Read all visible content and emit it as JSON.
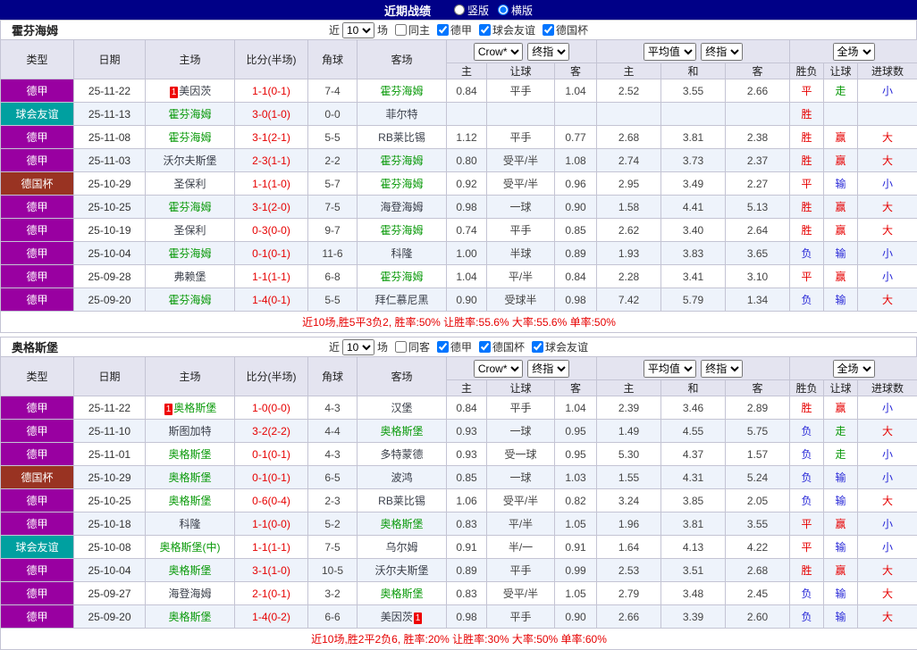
{
  "topbar": {
    "title": "近期战绩",
    "radios": [
      {
        "label": "竖版",
        "checked": false
      },
      {
        "label": "横版",
        "checked": true
      }
    ]
  },
  "league_colors": {
    "德甲": "#9900a1",
    "球会友谊": "#00a0a0",
    "德国杯": "#993322"
  },
  "result_colors": {
    "胜": "#e60000",
    "平": "#e60000",
    "负": "#2828d7",
    "赢": "#e60000",
    "输": "#2828d7",
    "走": "#0c9a0c",
    "大": "#e60000",
    "小": "#2828d7"
  },
  "columns": {
    "type": "类型",
    "date": "日期",
    "home": "主场",
    "score": "比分(半场)",
    "corner": "角球",
    "away": "客场",
    "h": "主",
    "handicap": "让球",
    "a": "客",
    "avg_h": "主",
    "avg_d": "和",
    "avg_a": "客",
    "wdl": "胜负",
    "asian": "让球",
    "goals": "进球数"
  },
  "tables": [
    {
      "team": "霍芬海姆",
      "filter": {
        "prefix": "近",
        "count": "10",
        "suffix": "场",
        "same": {
          "label": "同主",
          "checked": false
        },
        "leagues": [
          {
            "label": "德甲",
            "checked": true
          },
          {
            "label": "球会友谊",
            "checked": true
          },
          {
            "label": "德国杯",
            "checked": true
          }
        ]
      },
      "dropdowns": {
        "company": "Crow*",
        "stage1": "终指",
        "avg": "平均值",
        "stage2": "终指",
        "full": "全场"
      },
      "rows": [
        {
          "league": "德甲",
          "date": "25-11-22",
          "home": "美因茨",
          "home_rank": "1",
          "home_focus": false,
          "score": "1-1(0-1)",
          "corner": "7-4",
          "away": "霍芬海姆",
          "away_focus": true,
          "odds": [
            "0.84",
            "平手",
            "1.04"
          ],
          "avg": [
            "2.52",
            "3.55",
            "2.66"
          ],
          "results": [
            "平",
            "走",
            "小"
          ]
        },
        {
          "league": "球会友谊",
          "date": "25-11-13",
          "home": "霍芬海姆",
          "home_focus": true,
          "score": "3-0(1-0)",
          "corner": "0-0",
          "away": "菲尔特",
          "away_focus": false,
          "odds": [
            "",
            "",
            ""
          ],
          "avg": [
            "",
            "",
            ""
          ],
          "results": [
            "胜",
            "",
            ""
          ]
        },
        {
          "league": "德甲",
          "date": "25-11-08",
          "home": "霍芬海姆",
          "home_focus": true,
          "score": "3-1(2-1)",
          "corner": "5-5",
          "away": "RB莱比锡",
          "away_focus": false,
          "odds": [
            "1.12",
            "平手",
            "0.77"
          ],
          "avg": [
            "2.68",
            "3.81",
            "2.38"
          ],
          "results": [
            "胜",
            "赢",
            "大"
          ]
        },
        {
          "league": "德甲",
          "date": "25-11-03",
          "home": "沃尔夫斯堡",
          "home_focus": false,
          "score": "2-3(1-1)",
          "corner": "2-2",
          "away": "霍芬海姆",
          "away_focus": true,
          "odds": [
            "0.80",
            "受平/半",
            "1.08"
          ],
          "avg": [
            "2.74",
            "3.73",
            "2.37"
          ],
          "results": [
            "胜",
            "赢",
            "大"
          ]
        },
        {
          "league": "德国杯",
          "date": "25-10-29",
          "home": "圣保利",
          "home_focus": false,
          "score": "1-1(1-0)",
          "corner": "5-7",
          "away": "霍芬海姆",
          "away_focus": true,
          "odds": [
            "0.92",
            "受平/半",
            "0.96"
          ],
          "avg": [
            "2.95",
            "3.49",
            "2.27"
          ],
          "results": [
            "平",
            "输",
            "小"
          ]
        },
        {
          "league": "德甲",
          "date": "25-10-25",
          "home": "霍芬海姆",
          "home_focus": true,
          "score": "3-1(2-0)",
          "corner": "7-5",
          "away": "海登海姆",
          "away_focus": false,
          "odds": [
            "0.98",
            "一球",
            "0.90"
          ],
          "avg": [
            "1.58",
            "4.41",
            "5.13"
          ],
          "results": [
            "胜",
            "赢",
            "大"
          ]
        },
        {
          "league": "德甲",
          "date": "25-10-19",
          "home": "圣保利",
          "home_focus": false,
          "score": "0-3(0-0)",
          "corner": "9-7",
          "away": "霍芬海姆",
          "away_focus": true,
          "odds": [
            "0.74",
            "平手",
            "0.85"
          ],
          "avg": [
            "2.62",
            "3.40",
            "2.64"
          ],
          "results": [
            "胜",
            "赢",
            "大"
          ]
        },
        {
          "league": "德甲",
          "date": "25-10-04",
          "home": "霍芬海姆",
          "home_focus": true,
          "score": "0-1(0-1)",
          "corner": "11-6",
          "away": "科隆",
          "away_focus": false,
          "odds": [
            "1.00",
            "半球",
            "0.89"
          ],
          "avg": [
            "1.93",
            "3.83",
            "3.65"
          ],
          "results": [
            "负",
            "输",
            "小"
          ]
        },
        {
          "league": "德甲",
          "date": "25-09-28",
          "home": "弗赖堡",
          "home_focus": false,
          "score": "1-1(1-1)",
          "corner": "6-8",
          "away": "霍芬海姆",
          "away_focus": true,
          "odds": [
            "1.04",
            "平/半",
            "0.84"
          ],
          "avg": [
            "2.28",
            "3.41",
            "3.10"
          ],
          "results": [
            "平",
            "赢",
            "小"
          ]
        },
        {
          "league": "德甲",
          "date": "25-09-20",
          "home": "霍芬海姆",
          "home_focus": true,
          "score": "1-4(0-1)",
          "corner": "5-5",
          "away": "拜仁慕尼黑",
          "away_focus": false,
          "odds": [
            "0.90",
            "受球半",
            "0.98"
          ],
          "avg": [
            "7.42",
            "5.79",
            "1.34"
          ],
          "results": [
            "负",
            "输",
            "大"
          ]
        }
      ],
      "summary": "近10场,胜5平3负2, 胜率:50% 让胜率:55.6% 大率:55.6% 单率:50%"
    },
    {
      "team": "奥格斯堡",
      "filter": {
        "prefix": "近",
        "count": "10",
        "suffix": "场",
        "same": {
          "label": "同客",
          "checked": false
        },
        "leagues": [
          {
            "label": "德甲",
            "checked": true
          },
          {
            "label": "德国杯",
            "checked": true
          },
          {
            "label": "球会友谊",
            "checked": true
          }
        ]
      },
      "dropdowns": {
        "company": "Crow*",
        "stage1": "终指",
        "avg": "平均值",
        "stage2": "终指",
        "full": "全场"
      },
      "rows": [
        {
          "league": "德甲",
          "date": "25-11-22",
          "home": "奥格斯堡",
          "home_rank": "1",
          "home_focus": true,
          "score": "1-0(0-0)",
          "corner": "4-3",
          "away": "汉堡",
          "away_focus": false,
          "odds": [
            "0.84",
            "平手",
            "1.04"
          ],
          "avg": [
            "2.39",
            "3.46",
            "2.89"
          ],
          "results": [
            "胜",
            "赢",
            "小"
          ]
        },
        {
          "league": "德甲",
          "date": "25-11-10",
          "home": "斯图加特",
          "home_focus": false,
          "score": "3-2(2-2)",
          "corner": "4-4",
          "away": "奥格斯堡",
          "away_focus": true,
          "odds": [
            "0.93",
            "一球",
            "0.95"
          ],
          "avg": [
            "1.49",
            "4.55",
            "5.75"
          ],
          "results": [
            "负",
            "走",
            "大"
          ]
        },
        {
          "league": "德甲",
          "date": "25-11-01",
          "home": "奥格斯堡",
          "home_focus": true,
          "score": "0-1(0-1)",
          "corner": "4-3",
          "away": "多特蒙德",
          "away_focus": false,
          "odds": [
            "0.93",
            "受一球",
            "0.95"
          ],
          "avg": [
            "5.30",
            "4.37",
            "1.57"
          ],
          "results": [
            "负",
            "走",
            "小"
          ]
        },
        {
          "league": "德国杯",
          "date": "25-10-29",
          "home": "奥格斯堡",
          "home_focus": true,
          "score": "0-1(0-1)",
          "corner": "6-5",
          "away": "波鸿",
          "away_focus": false,
          "odds": [
            "0.85",
            "一球",
            "1.03"
          ],
          "avg": [
            "1.55",
            "4.31",
            "5.24"
          ],
          "results": [
            "负",
            "输",
            "小"
          ]
        },
        {
          "league": "德甲",
          "date": "25-10-25",
          "home": "奥格斯堡",
          "home_focus": true,
          "score": "0-6(0-4)",
          "corner": "2-3",
          "away": "RB莱比锡",
          "away_focus": false,
          "odds": [
            "1.06",
            "受平/半",
            "0.82"
          ],
          "avg": [
            "3.24",
            "3.85",
            "2.05"
          ],
          "results": [
            "负",
            "输",
            "大"
          ]
        },
        {
          "league": "德甲",
          "date": "25-10-18",
          "home": "科隆",
          "home_focus": false,
          "score": "1-1(0-0)",
          "corner": "5-2",
          "away": "奥格斯堡",
          "away_focus": true,
          "odds": [
            "0.83",
            "平/半",
            "1.05"
          ],
          "avg": [
            "1.96",
            "3.81",
            "3.55"
          ],
          "results": [
            "平",
            "赢",
            "小"
          ]
        },
        {
          "league": "球会友谊",
          "date": "25-10-08",
          "home": "奥格斯堡(中)",
          "home_focus": true,
          "score": "1-1(1-1)",
          "corner": "7-5",
          "away": "乌尔姆",
          "away_focus": false,
          "odds": [
            "0.91",
            "半/一",
            "0.91"
          ],
          "avg": [
            "1.64",
            "4.13",
            "4.22"
          ],
          "results": [
            "平",
            "输",
            "小"
          ]
        },
        {
          "league": "德甲",
          "date": "25-10-04",
          "home": "奥格斯堡",
          "home_focus": true,
          "score": "3-1(1-0)",
          "corner": "10-5",
          "away": "沃尔夫斯堡",
          "away_focus": false,
          "odds": [
            "0.89",
            "平手",
            "0.99"
          ],
          "avg": [
            "2.53",
            "3.51",
            "2.68"
          ],
          "results": [
            "胜",
            "赢",
            "大"
          ]
        },
        {
          "league": "德甲",
          "date": "25-09-27",
          "home": "海登海姆",
          "home_focus": false,
          "score": "2-1(0-1)",
          "corner": "3-2",
          "away": "奥格斯堡",
          "away_focus": true,
          "odds": [
            "0.83",
            "受平/半",
            "1.05"
          ],
          "avg": [
            "2.79",
            "3.48",
            "2.45"
          ],
          "results": [
            "负",
            "输",
            "大"
          ]
        },
        {
          "league": "德甲",
          "date": "25-09-20",
          "home": "奥格斯堡",
          "home_focus": true,
          "score": "1-4(0-2)",
          "corner": "6-6",
          "away": "美因茨",
          "away_rank": "1",
          "away_focus": false,
          "odds": [
            "0.98",
            "平手",
            "0.90"
          ],
          "avg": [
            "2.66",
            "3.39",
            "2.60"
          ],
          "results": [
            "负",
            "输",
            "大"
          ]
        }
      ],
      "summary": "近10场,胜2平2负6, 胜率:20% 让胜率:30% 大率:50% 单率:60%"
    }
  ]
}
